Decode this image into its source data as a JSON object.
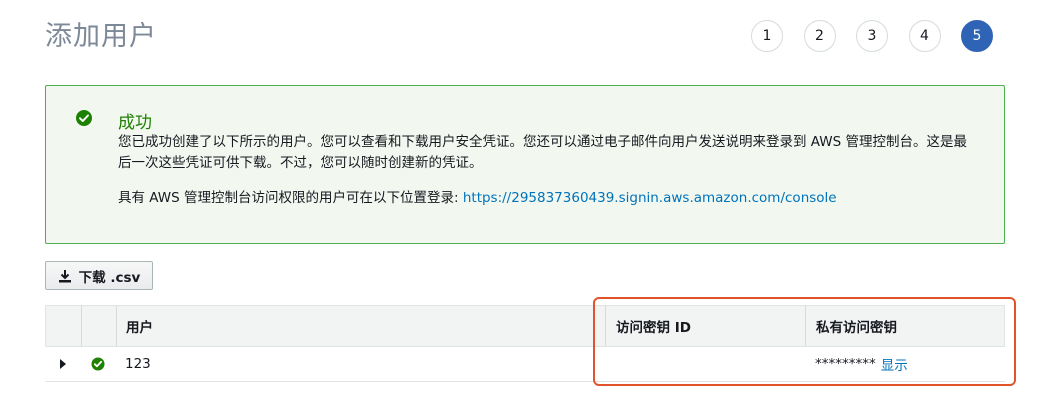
{
  "page": {
    "title": "添加用户"
  },
  "wizard_steps": [
    {
      "label": "1",
      "active": false
    },
    {
      "label": "2",
      "active": false
    },
    {
      "label": "3",
      "active": false
    },
    {
      "label": "4",
      "active": false
    },
    {
      "label": "5",
      "active": true
    }
  ],
  "alert": {
    "title": "成功",
    "message": "您已成功创建了以下所示的用户。您可以查看和下载用户安全凭证。您还可以通过电子邮件向用户发送说明来登录到 AWS 管理控制台。这是最后一次这些凭证可供下载。不过，您可以随时创建新的凭证。",
    "login_text": "具有 AWS 管理控制台访问权限的用户可在以下位置登录:",
    "login_url": "https://295837360439.signin.aws.amazon.com/console"
  },
  "download_button": {
    "label": "下载 .csv"
  },
  "table": {
    "columns": {
      "user": "用户",
      "access_key_id": "访问密钥 ID",
      "secret_key": "私有访问密钥"
    },
    "rows": [
      {
        "user": "123",
        "access_key_id": "",
        "secret_masked": "*********",
        "show_link": "显示"
      }
    ]
  },
  "colors": {
    "accent": "#2f63b5",
    "success": "#1d8102",
    "link": "#0073bb",
    "highlight": "#e2532c"
  }
}
